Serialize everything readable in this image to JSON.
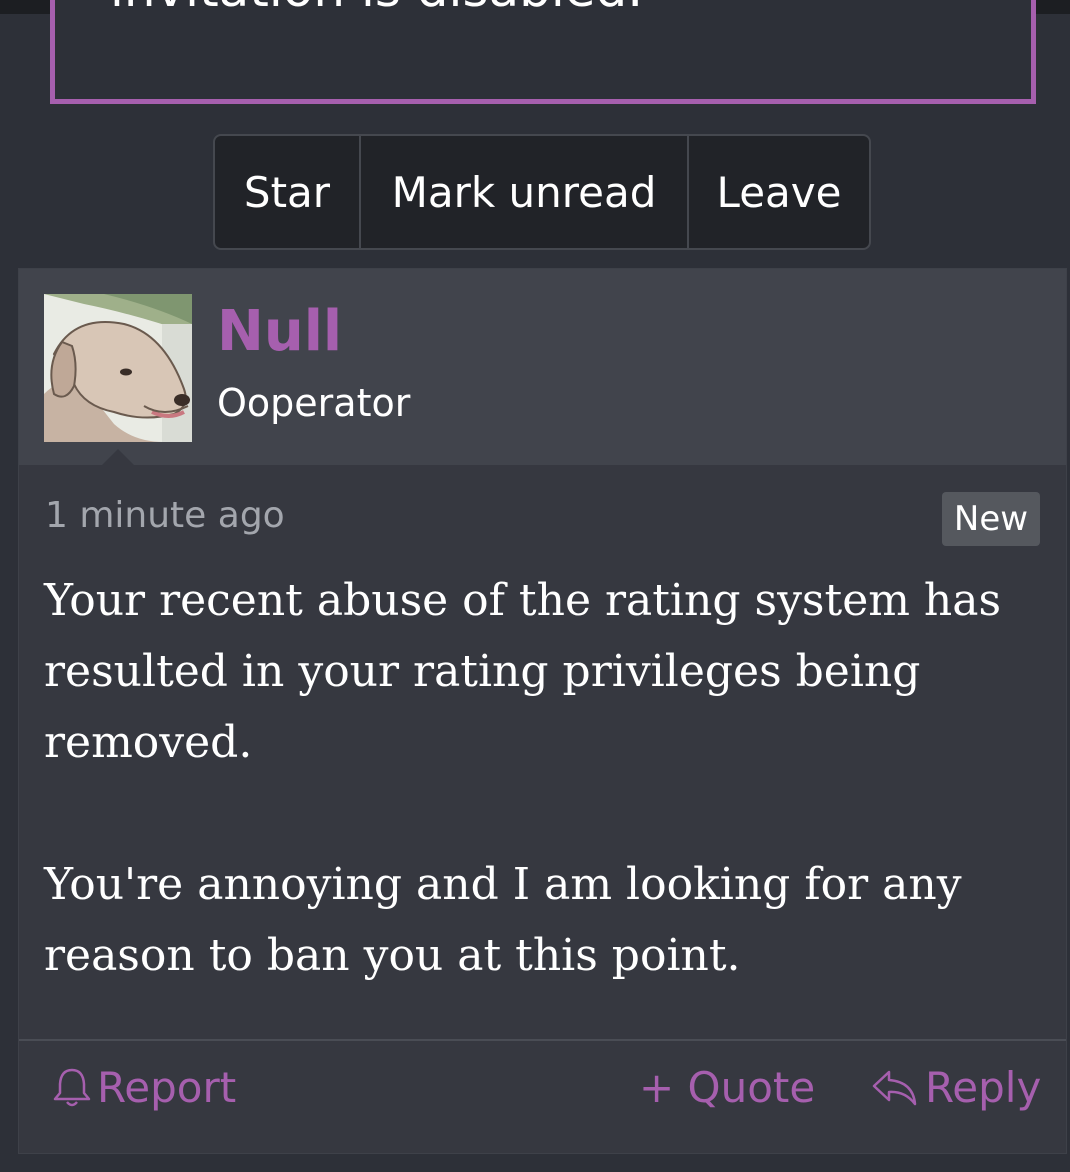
{
  "notice": {
    "text": "invitation is disabled."
  },
  "actions": {
    "star": "Star",
    "mark_unread": "Mark unread",
    "leave": "Leave"
  },
  "post": {
    "author": "Null",
    "author_title": "Ooperator",
    "timestamp": "1 minute ago",
    "badge": "New",
    "paragraphs": [
      "Your recent abuse of the rating system has resulted in your rating privileges being removed.",
      "You're annoying and I am looking for any reason to ban you at this point."
    ],
    "footer": {
      "report": "Report",
      "quote": "+ Quote",
      "reply": "Reply"
    }
  },
  "colors": {
    "accent": "#a65fae",
    "background": "#2d3038",
    "post_body": "#363840",
    "post_header": "#41444c"
  },
  "icons": {
    "report": "bell-icon",
    "reply": "reply-arrow-icon"
  }
}
